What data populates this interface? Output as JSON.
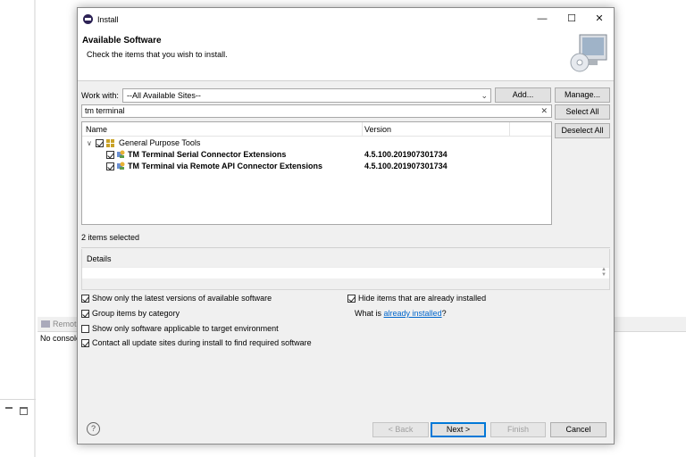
{
  "background": {
    "console_tab": "Remot",
    "console_text": "No console"
  },
  "dialog": {
    "title": "Install",
    "header_title": "Available Software",
    "header_description": "Check the items that you wish to install.",
    "work_with_label": "Work with:",
    "work_with_value": "--All Available Sites--",
    "add_button": "Add...",
    "manage_button": "Manage...",
    "filter_value": "tm terminal",
    "select_all_button": "Select All",
    "deselect_all_button": "Deselect All",
    "columns": {
      "name": "Name",
      "version": "Version"
    },
    "category": {
      "label": "General Purpose Tools",
      "checked": true
    },
    "items": [
      {
        "name": "TM Terminal Serial Connector Extensions",
        "version": "4.5.100.201907301734",
        "checked": true
      },
      {
        "name": "TM Terminal via Remote API Connector Extensions",
        "version": "4.5.100.201907301734",
        "checked": true
      }
    ],
    "selection_status": "2 items selected",
    "details_label": "Details",
    "options": {
      "latest_only": "Show only the latest versions of available software",
      "hide_installed": "Hide items that are already installed",
      "group_by_category": "Group items by category",
      "what_is_prefix": "What is",
      "already_installed_link": "already installed",
      "what_is_suffix": "?",
      "target_env": "Show only software applicable to target environment",
      "contact_sites": "Contact all update sites during install to find required software"
    },
    "buttons": {
      "help": "?",
      "back": "< Back",
      "next": "Next >",
      "finish": "Finish",
      "cancel": "Cancel"
    }
  }
}
